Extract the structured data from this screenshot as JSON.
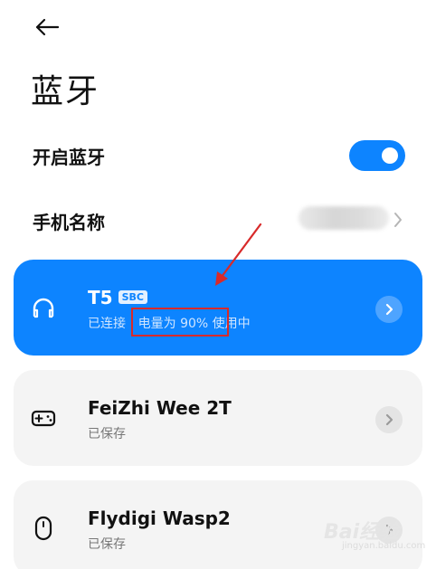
{
  "header": {
    "back_icon": "arrow-left-icon",
    "title": "蓝牙"
  },
  "settings": {
    "bluetooth_label": "开启蓝牙",
    "bluetooth_enabled": true,
    "phone_name_label": "手机名称"
  },
  "devices": [
    {
      "name": "T5",
      "codec": "SBC",
      "status_prefix": "已连接 | ",
      "battery": "电量为 90%",
      "status_suffix": " 使用中",
      "icon": "headphones-icon",
      "connected": true
    },
    {
      "name": "FeiZhi Wee 2T",
      "status": "已保存",
      "icon": "gamepad-icon",
      "connected": false
    },
    {
      "name": "Flydigi Wasp2",
      "status": "已保存",
      "icon": "mouse-icon",
      "connected": false
    }
  ],
  "watermark": {
    "brand": "Bai经验",
    "url": "jingyan.baidu.com"
  },
  "colors": {
    "accent": "#0d84ff",
    "highlight": "#d82a2a",
    "card_bg": "#f4f4f4"
  }
}
